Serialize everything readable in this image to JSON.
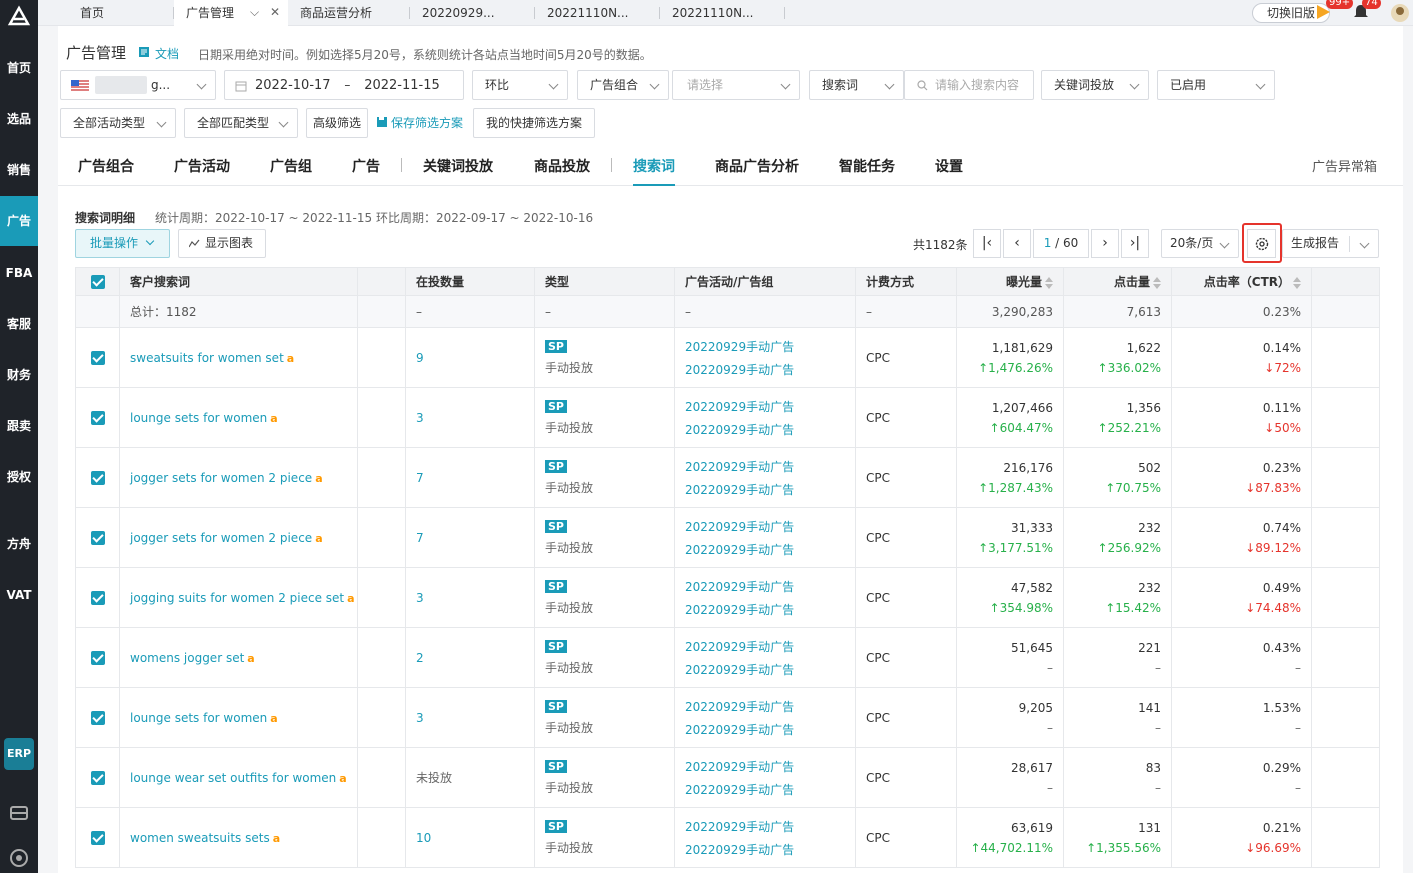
{
  "sidebar": {
    "items": [
      "首页",
      "选品",
      "销售",
      "广告",
      "FBA",
      "客服",
      "财务",
      "跟卖",
      "授权",
      "方舟",
      "VAT"
    ],
    "active": "广告",
    "erp": "ERP"
  },
  "tabs": [
    {
      "label": "首页"
    },
    {
      "label": "广告管理",
      "active": true
    },
    {
      "label": "商品运营分析"
    },
    {
      "label": "20220929..."
    },
    {
      "label": "20221110N..."
    },
    {
      "label": "20221110N..."
    }
  ],
  "topbar": {
    "switch_old": "切换旧版",
    "notif1": "99+",
    "notif2": "74"
  },
  "header": {
    "title": "广告管理",
    "doc": "文档",
    "note": "日期采用绝对时间。例如选择5月20号，系统则统计各站点当地时间5月20号的数据。"
  },
  "filters": {
    "store": "g...",
    "date_start": "2022-10-17",
    "date_sep": "–",
    "date_end": "2022-11-15",
    "compare": "环比",
    "group_type": "广告组合",
    "group_ph": "请选择",
    "search_type": "搜索词",
    "search_ph": "请输入搜索内容",
    "kw_type": "关键词投放",
    "status": "已启用",
    "activity_type": "全部活动类型",
    "match_type": "全部匹配类型",
    "advanced": "高级筛选",
    "save_plan": "保存筛选方案",
    "my_plans": "我的快捷筛选方案"
  },
  "subtabs": [
    "广告组合",
    "广告活动",
    "广告组",
    "广告",
    "关键词投放",
    "商品投放",
    "搜索词",
    "商品广告分析",
    "智能任务",
    "设置"
  ],
  "anomaly": "广告异常箱",
  "detail": {
    "title": "搜索词明细",
    "period": "统计周期：2022-10-17 ~ 2022-11-15 环比周期：2022-09-17 ~ 2022-10-16",
    "batch": "批量操作",
    "show_chart": "显示图表",
    "total": "共1182条",
    "page_current": "1",
    "page_total": "/ 60",
    "per_page": "20条/页",
    "report": "生成报告"
  },
  "table": {
    "headers": [
      "客户搜索词",
      "",
      "在投数量",
      "类型",
      "广告活动/广告组",
      "计费方式",
      "曝光量",
      "点击量",
      "点击率（CTR）"
    ],
    "summary": {
      "label": "总计：1182",
      "count": "–",
      "type": "–",
      "campaign": "–",
      "billing": "–",
      "impressions": "3,290,283",
      "clicks": "7,613",
      "ctr": "0.23%"
    },
    "rows": [
      {
        "term": "sweatsuits for women set",
        "count": "9",
        "type_badge": "SP",
        "type_text": "手动投放",
        "campaign": "20220929手动广告",
        "group": "20220929手动广告",
        "billing": "CPC",
        "impressions": "1,181,629",
        "impr_chg": "↑1,476.26%",
        "impr_dir": "up",
        "clicks": "1,622",
        "clicks_chg": "↑336.02%",
        "clicks_dir": "up",
        "ctr": "0.14%",
        "ctr_chg": "↓72%",
        "ctr_dir": "down"
      },
      {
        "term": "lounge sets for women",
        "count": "3",
        "type_badge": "SP",
        "type_text": "手动投放",
        "campaign": "20220929手动广告",
        "group": "20220929手动广告",
        "billing": "CPC",
        "impressions": "1,207,466",
        "impr_chg": "↑604.47%",
        "impr_dir": "up",
        "clicks": "1,356",
        "clicks_chg": "↑252.21%",
        "clicks_dir": "up",
        "ctr": "0.11%",
        "ctr_chg": "↓50%",
        "ctr_dir": "down"
      },
      {
        "term": "jogger sets for women 2 piece",
        "count": "7",
        "type_badge": "SP",
        "type_text": "手动投放",
        "campaign": "20220929手动广告",
        "group": "20220929手动广告",
        "billing": "CPC",
        "impressions": "216,176",
        "impr_chg": "↑1,287.43%",
        "impr_dir": "up",
        "clicks": "502",
        "clicks_chg": "↑70.75%",
        "clicks_dir": "up",
        "ctr": "0.23%",
        "ctr_chg": "↓87.83%",
        "ctr_dir": "down"
      },
      {
        "term": "jogger sets for women 2 piece",
        "count": "7",
        "type_badge": "SP",
        "type_text": "手动投放",
        "campaign": "20220929手动广告",
        "group": "20220929手动广告",
        "billing": "CPC",
        "impressions": "31,333",
        "impr_chg": "↑3,177.51%",
        "impr_dir": "up",
        "clicks": "232",
        "clicks_chg": "↑256.92%",
        "clicks_dir": "up",
        "ctr": "0.74%",
        "ctr_chg": "↓89.12%",
        "ctr_dir": "down"
      },
      {
        "term": "jogging suits for women 2 piece set",
        "count": "3",
        "type_badge": "SP",
        "type_text": "手动投放",
        "campaign": "20220929手动广告",
        "group": "20220929手动广告",
        "billing": "CPC",
        "impressions": "47,582",
        "impr_chg": "↑354.98%",
        "impr_dir": "up",
        "clicks": "232",
        "clicks_chg": "↑15.42%",
        "clicks_dir": "up",
        "ctr": "0.49%",
        "ctr_chg": "↓74.48%",
        "ctr_dir": "down"
      },
      {
        "term": "womens jogger set",
        "count": "2",
        "type_badge": "SP",
        "type_text": "手动投放",
        "campaign": "20220929手动广告",
        "group": "20220929手动广告",
        "billing": "CPC",
        "impressions": "51,645",
        "impr_chg": "–",
        "impr_dir": "none",
        "clicks": "221",
        "clicks_chg": "–",
        "clicks_dir": "none",
        "ctr": "0.43%",
        "ctr_chg": "–",
        "ctr_dir": "none"
      },
      {
        "term": "lounge sets for women",
        "count": "3",
        "type_badge": "SP",
        "type_text": "手动投放",
        "campaign": "20220929手动广告",
        "group": "20220929手动广告",
        "billing": "CPC",
        "impressions": "9,205",
        "impr_chg": "–",
        "impr_dir": "none",
        "clicks": "141",
        "clicks_chg": "–",
        "clicks_dir": "none",
        "ctr": "1.53%",
        "ctr_chg": "–",
        "ctr_dir": "none"
      },
      {
        "term": "lounge wear set outfits for women",
        "count": "未投放",
        "type_badge": "SP",
        "type_text": "手动投放",
        "campaign": "20220929手动广告",
        "group": "20220929手动广告",
        "billing": "CPC",
        "impressions": "28,617",
        "impr_chg": "–",
        "impr_dir": "none",
        "clicks": "83",
        "clicks_chg": "–",
        "clicks_dir": "none",
        "ctr": "0.29%",
        "ctr_chg": "–",
        "ctr_dir": "none"
      },
      {
        "term": "women sweatsuits sets",
        "count": "10",
        "type_badge": "SP",
        "type_text": "手动投放",
        "campaign": "20220929手动广告",
        "group": "20220929手动广告",
        "billing": "CPC",
        "impressions": "63,619",
        "impr_chg": "↑44,702.11%",
        "impr_dir": "up",
        "clicks": "131",
        "clicks_chg": "↑1,355.56%",
        "clicks_dir": "up",
        "ctr": "0.21%",
        "ctr_chg": "↓96.69%",
        "ctr_dir": "down"
      }
    ]
  },
  "colors": {
    "accent": "#1a9bb8",
    "sidebar": "#1f2329",
    "up": "#27b04a",
    "down": "#e5342c",
    "highlight": "#e5342c"
  }
}
